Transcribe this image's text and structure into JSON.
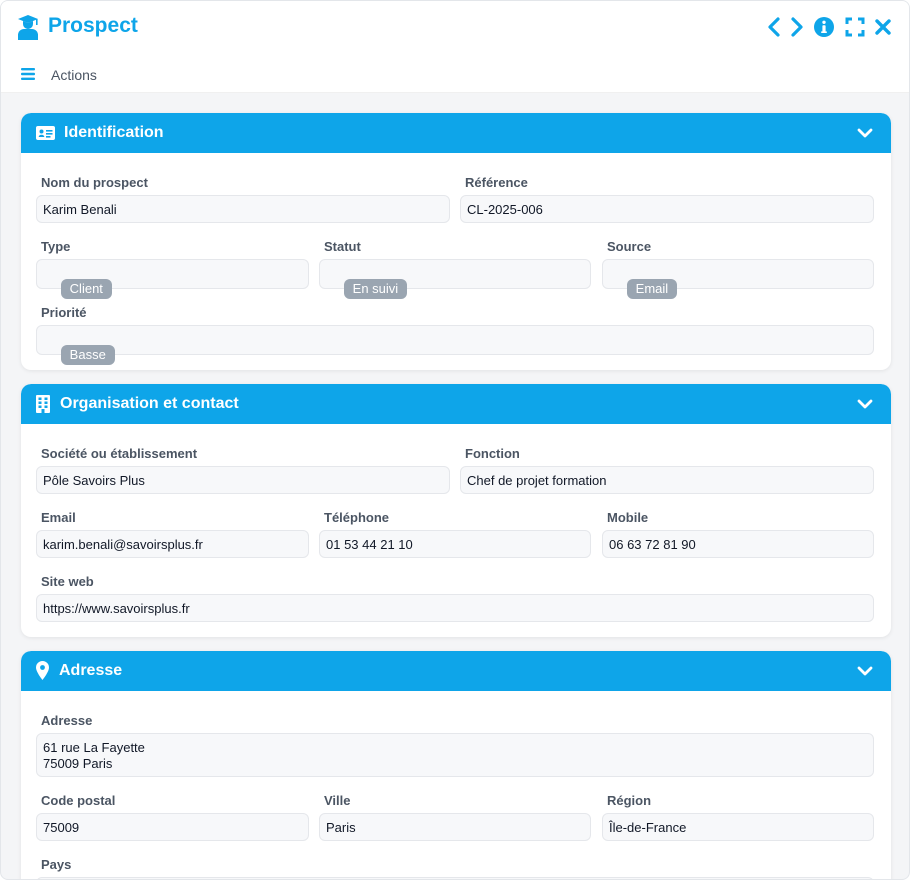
{
  "window": {
    "title": "Prospect"
  },
  "toolbar": {
    "actions_label": "Actions"
  },
  "colors": {
    "accent": "#0ea5e9",
    "tag": "#9aa5b1"
  },
  "identification": {
    "title": "Identification",
    "nom_label": "Nom du prospect",
    "nom_value": "Karim Benali",
    "ref_label": "Référence",
    "ref_value": "CL-2025-006",
    "type_label": "Type",
    "type_value": "Client",
    "statut_label": "Statut",
    "statut_value": "En suivi",
    "source_label": "Source",
    "source_value": "Email",
    "priorite_label": "Priorité",
    "priorite_value": "Basse"
  },
  "organisation": {
    "title": "Organisation et contact",
    "societe_label": "Société ou établissement",
    "societe_value": "Pôle Savoirs Plus",
    "fonction_label": "Fonction",
    "fonction_value": "Chef de projet formation",
    "email_label": "Email",
    "email_value": "karim.benali@savoirsplus.fr",
    "tel_label": "Téléphone",
    "tel_value": "01 53 44 21 10",
    "mobile_label": "Mobile",
    "mobile_value": "06 63 72 81 90",
    "site_label": "Site web",
    "site_value": "https://www.savoirsplus.fr"
  },
  "adresse": {
    "title": "Adresse",
    "adresse_label": "Adresse",
    "adresse_value": "61 rue La Fayette\n75009 Paris",
    "cp_label": "Code postal",
    "cp_value": "75009",
    "ville_label": "Ville",
    "ville_value": "Paris",
    "region_label": "Région",
    "region_value": "Île-de-France",
    "pays_label": "Pays"
  },
  "icons": {
    "app": "user-graduate-icon",
    "prev": "chevron-left-icon",
    "next": "chevron-right-icon",
    "info": "info-circle-icon",
    "expand": "expand-icon",
    "close": "close-icon",
    "menu": "hamburger-menu-icon",
    "id_card": "id-card-icon",
    "building": "building-icon",
    "map_pin": "map-pin-icon",
    "collapse": "chevron-down-icon"
  }
}
